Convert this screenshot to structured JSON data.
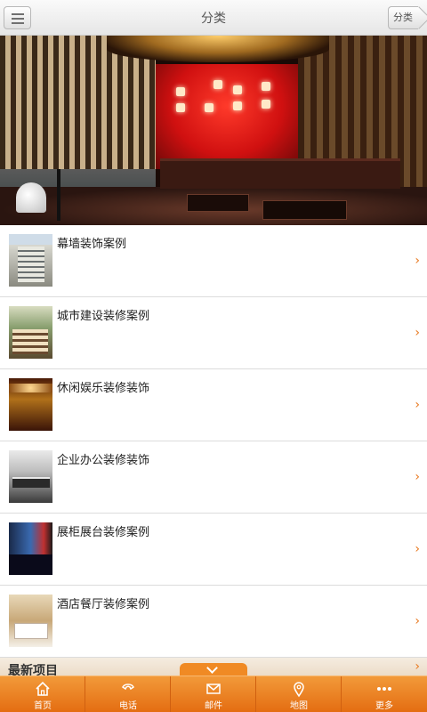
{
  "header": {
    "title": "分类",
    "category_button": "分类"
  },
  "banner": {
    "slide_count": 5,
    "active_slide": 1
  },
  "categories": [
    {
      "label": "幕墙装饰案例"
    },
    {
      "label": "城市建设装修案例"
    },
    {
      "label": "休闲娱乐装修装饰"
    },
    {
      "label": "企业办公装修装饰"
    },
    {
      "label": "展柜展台装修案例"
    },
    {
      "label": "酒店餐厅装修案例"
    }
  ],
  "section": {
    "title": "最新项目"
  },
  "bottom_nav": [
    {
      "label": "首页",
      "icon": "home-icon"
    },
    {
      "label": "电话",
      "icon": "phone-icon"
    },
    {
      "label": "邮件",
      "icon": "mail-icon"
    },
    {
      "label": "地图",
      "icon": "map-pin-icon"
    },
    {
      "label": "更多",
      "icon": "more-icon"
    }
  ],
  "colors": {
    "accent": "#e8781e",
    "nav_background": "#ee8a2a",
    "section_background": "#f2e6d6"
  }
}
